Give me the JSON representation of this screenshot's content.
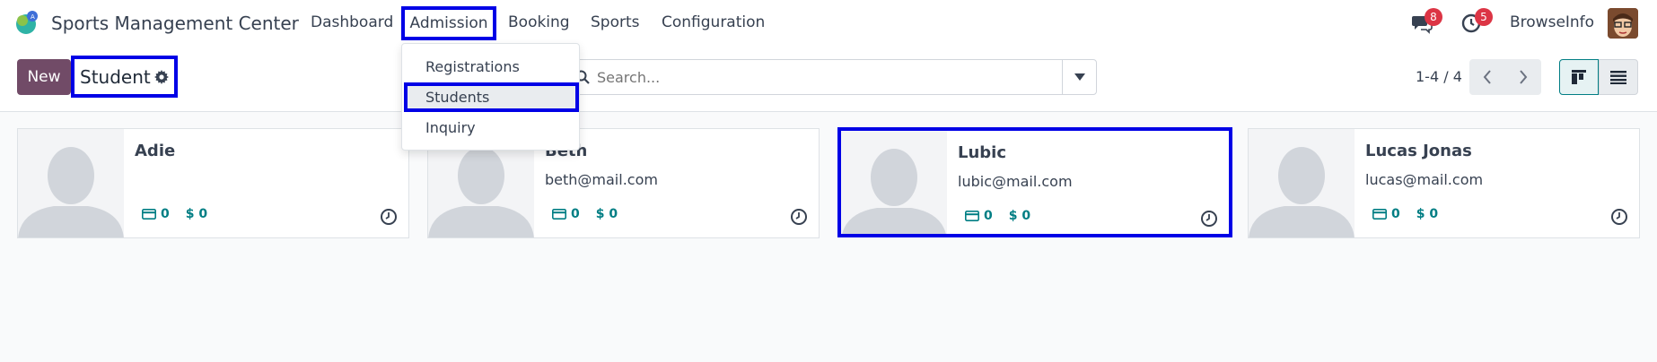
{
  "app": {
    "title": "Sports Management Center",
    "logo_icon": "app-logo-icon"
  },
  "nav": {
    "items": [
      {
        "label": "Dashboard"
      },
      {
        "label": "Admission"
      },
      {
        "label": "Booking"
      },
      {
        "label": "Sports"
      },
      {
        "label": "Configuration"
      }
    ]
  },
  "systray": {
    "messages_badge": "8",
    "activity_badge": "5",
    "company": "BrowseInfo"
  },
  "admission_menu": {
    "items": [
      {
        "label": "Registrations"
      },
      {
        "label": "Students"
      },
      {
        "label": "Inquiry"
      }
    ]
  },
  "control": {
    "new_label": "New",
    "breadcrumb": "Student",
    "search_placeholder": "Search...",
    "pager": "1-4 / 4"
  },
  "cards": [
    {
      "name": "Adie",
      "email": "",
      "card_count": "0",
      "amount": "$ 0"
    },
    {
      "name": "Beth",
      "email": "beth@mail.com",
      "card_count": "0",
      "amount": "$ 0"
    },
    {
      "name": "Lubic",
      "email": "lubic@mail.com",
      "card_count": "0",
      "amount": "$ 0"
    },
    {
      "name": "Lucas Jonas",
      "email": "lucas@mail.com",
      "card_count": "0",
      "amount": "$ 0"
    }
  ],
  "colors": {
    "primary": "#714b67",
    "accent": "#017e84",
    "highlight": "#0000e6",
    "badge": "#dc3545"
  }
}
